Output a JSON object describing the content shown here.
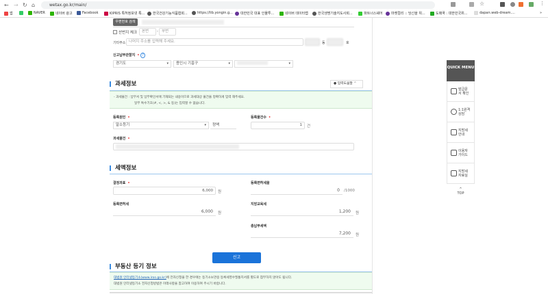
{
  "browser": {
    "url": "wetax.go.kr/main/",
    "bookmarks": [
      "앱",
      "NAVER",
      "네이버 광고",
      "Facebook",
      "KIPRIS 특허정보넷 특...",
      "한국건강기능식품협회...",
      "https://lib.yongin.g...",
      "대한민국 대표 인물투...",
      "네이버 데이터랩",
      "한국생명기술지도사회...",
      "파트너스쉐어",
      "마켓컬리 :: 당신을 위...",
      "도매꾹 : 대한민국위...",
      "dapan.web-dream...."
    ],
    "more": "»"
  },
  "address": {
    "postcode_button": "우편번호 검색",
    "mountain_check": "산번지 체크",
    "main_no_placeholder": "본번",
    "sub_no_placeholder": "부번",
    "dash": "-",
    "etc_label": "기타주소",
    "etc_placeholder": "나머지 주소를 입력해 주세요.",
    "dong": "동",
    "ho": "호",
    "jurisdiction_label": "신고납부관할지",
    "province": "경기도",
    "city": "용인시 기흥구",
    "help_icon": "?"
  },
  "tax_info": {
    "title": "과세정보",
    "help_button": "입력도움말",
    "notice_line1": "- 과세물건 : 납부서 및 납부확인서에 기재되는 내용이므로 과세대상 물건을 정확하게 입력 해주세요.",
    "notice_line2": "일부 특수기호(#, <, >, & 등)는 입력할 수 없습니다.",
    "cause_label": "등록원인",
    "cause_value": "말소등기",
    "cause_sub": "정액",
    "count_label": "등록물건수",
    "count_value": "1",
    "count_unit": "건",
    "object_label": "과세물건"
  },
  "amount_info": {
    "title": "세액정보",
    "base_label": "결정과표",
    "base_value": "6,000",
    "rate_label": "등록면허세율",
    "rate_value": "0",
    "rate_unit": "/1000",
    "reg_tax_label": "등록면허세",
    "reg_tax_value": "6,000",
    "edu_tax_label": "지방교육세",
    "edu_tax_value": "1,200",
    "total_label": "총납부세액",
    "total_value": "7,200",
    "won": "원"
  },
  "submit": "신고",
  "registry": {
    "title": "부동산 등기 정보",
    "link": "대법원 인터넷등기소(www.iros.go.kr)",
    "line1": "에 전자신청을 한 경우에는 등기소보관용 등록세영수필통지서를 별도로 첨부하지 않아도 됩니다.",
    "line2": "대법원 인터넷등기소 전자신청방법은 아래사항을 참고하여 이용하여 주시기 바랍니다."
  },
  "quick_menu": {
    "title": "QUICK MENU",
    "items": [
      "발급문서 확인",
      "1:1원격 상담",
      "지방세 안내",
      "이용자 가이드",
      "지방세 자료실"
    ],
    "top": "TOP"
  },
  "colors": {
    "accent": "#3a8be0",
    "submit": "#1a73d9",
    "quick_header": "#555555"
  }
}
